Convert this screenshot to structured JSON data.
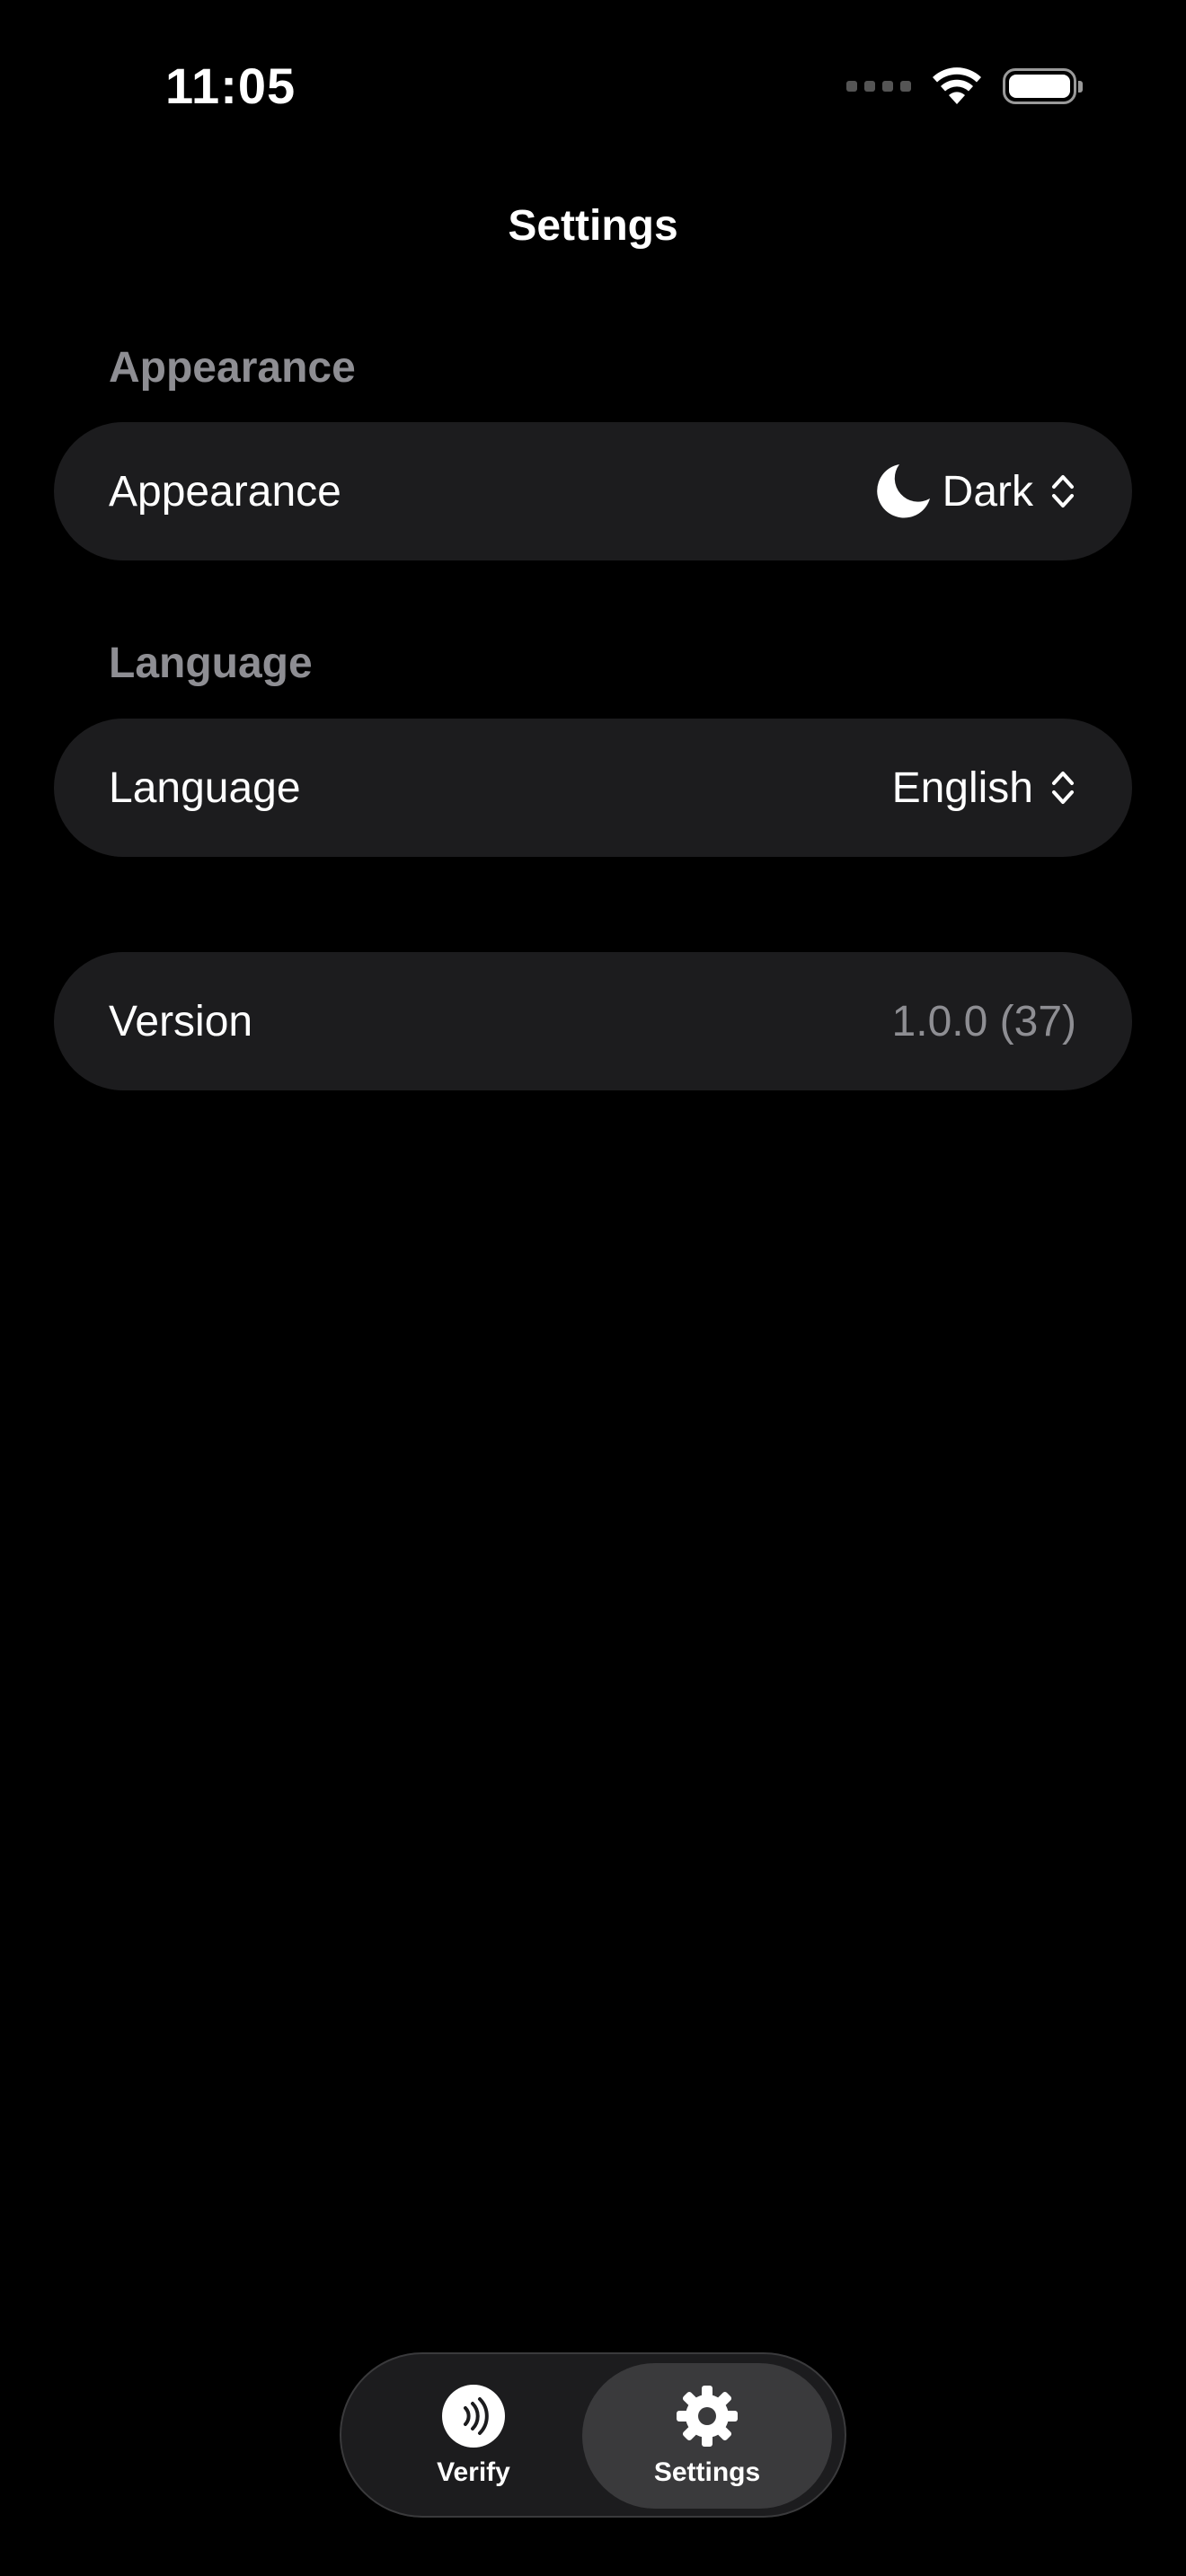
{
  "status_bar": {
    "time": "11:05",
    "icons": [
      "cellular-signal-icon",
      "wifi-icon",
      "battery-icon"
    ]
  },
  "nav": {
    "title": "Settings"
  },
  "sections": {
    "appearance": {
      "header": "Appearance",
      "row_label": "Appearance",
      "value": "Dark",
      "icon": "moon-icon"
    },
    "language": {
      "header": "Language",
      "row_label": "Language",
      "value": "English"
    },
    "about": {
      "row_label": "Version",
      "value": "1.0.0 (37)"
    }
  },
  "tabbar": {
    "tabs": [
      {
        "label": "Verify",
        "icon": "nfc-icon",
        "selected": false
      },
      {
        "label": "Settings",
        "icon": "gear-icon",
        "selected": true
      }
    ]
  },
  "colors": {
    "background": "#000000",
    "card": "#1c1c1e",
    "secondary_text": "#8e8e93",
    "selected_tab": "#3a3a3c"
  }
}
